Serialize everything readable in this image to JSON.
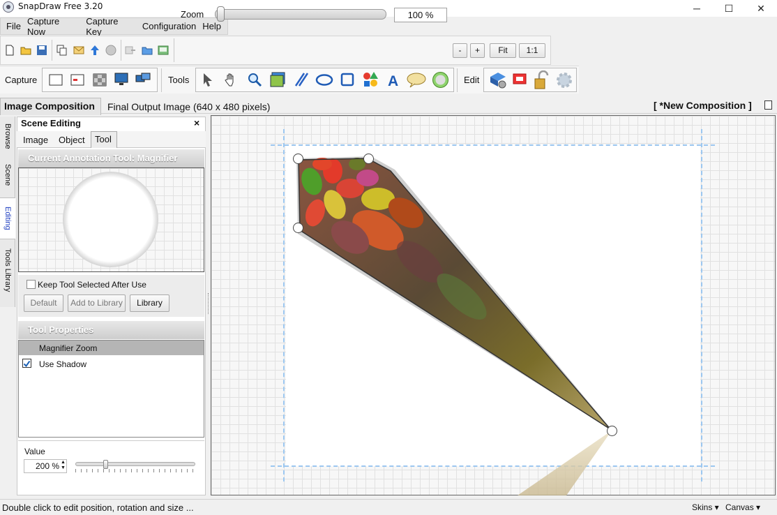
{
  "window": {
    "title": "SnapDraw Free 3.20"
  },
  "menu": [
    "File",
    "Capture Now",
    "Capture Key",
    "Configuration",
    "Help"
  ],
  "toolbar": {
    "zoom_label": "Zoom",
    "zoom_value": "100 %",
    "zoom_slider_fraction": 0.02,
    "minus": "-",
    "plus": "+",
    "fit": "Fit",
    "one_to_one": "1:1",
    "file_icons": [
      "new-document-icon",
      "open-folder-icon",
      "save-disk-icon",
      "copy-icon",
      "email-icon",
      "upload-arrow-icon",
      "web-globe-icon",
      "export-icon",
      "send-folder-icon",
      "image-export-icon"
    ]
  },
  "capture": {
    "label": "Capture",
    "icons": [
      "window-capture-icon",
      "region-capture-icon",
      "freehand-capture-icon",
      "screen-capture-icon",
      "multi-screen-capture-icon"
    ]
  },
  "tools": {
    "label": "Tools",
    "icons": [
      "arrow-pointer-icon",
      "hand-pan-icon",
      "magnifier-icon",
      "image-insert-icon",
      "line-tool-icon",
      "ellipse-tool-icon",
      "rectangle-tool-icon",
      "shapes-tool-icon",
      "text-tool-icon",
      "callout-tool-icon",
      "blur-tool-icon"
    ]
  },
  "edit": {
    "label": "Edit",
    "icons": [
      "effects-icon",
      "crop-icon",
      "lock-icon",
      "settings-icon"
    ]
  },
  "tabs": {
    "active": "Image Composition",
    "output": "Final Output Image (640 x 480 pixels)",
    "composition": "[ *New Composition ]"
  },
  "side_tabs": [
    "Browse",
    "Scene",
    "Editing",
    "Tools Library"
  ],
  "panel": {
    "title": "Scene Editing",
    "close": "×",
    "subtabs": [
      "Image",
      "Object",
      "Tool"
    ],
    "current_tool_header": "Current Annotation Tool: Magnifier",
    "keep_selected_label": "Keep Tool Selected After Use",
    "keep_selected_checked": false,
    "buttons": {
      "default": "Default",
      "add_to_library": "Add to Library",
      "library": "Library"
    },
    "tool_properties_header": "Tool Properties",
    "property_rows": [
      {
        "label": "Magnifier Zoom"
      },
      {
        "label": "Use Shadow",
        "checked": true
      }
    ],
    "value_label": "Value",
    "value": "200 %",
    "value_slider_fraction": 0.24
  },
  "status": {
    "text": "Double click to edit position, rotation and size ...",
    "skins": "Skins",
    "canvas": "Canvas"
  },
  "colors": {
    "accent_tab": "#2040c0",
    "guide_dash": "#9cc7f0",
    "check": "#1a5fb4"
  }
}
